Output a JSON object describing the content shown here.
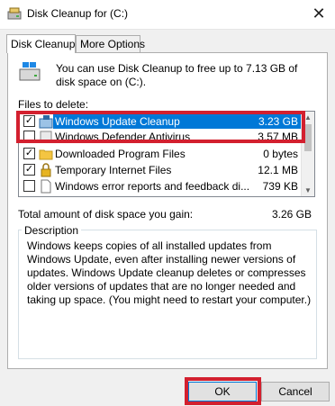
{
  "window": {
    "title": "Disk Cleanup for  (C:)",
    "close_glyph": "✕"
  },
  "tabs": [
    {
      "label": "Disk Cleanup",
      "active": true
    },
    {
      "label": "More Options",
      "active": false
    }
  ],
  "intro_text": "You can use Disk Cleanup to free up to 7.13 GB of disk space on  (C:).",
  "files_label": "Files to delete:",
  "files": [
    {
      "name": "Windows Update Cleanup",
      "size": "3.23 GB",
      "checked": true,
      "selected": true,
      "icon": "windows-update-icon"
    },
    {
      "name": "Windows Defender Antivirus",
      "size": "3.57 MB",
      "checked": false,
      "selected": false,
      "icon": "defender-icon"
    },
    {
      "name": "Downloaded Program Files",
      "size": "0 bytes",
      "checked": true,
      "selected": false,
      "icon": "folder-icon"
    },
    {
      "name": "Temporary Internet Files",
      "size": "12.1 MB",
      "checked": true,
      "selected": false,
      "icon": "lock-icon"
    },
    {
      "name": "Windows error reports and feedback di...",
      "size": "739 KB",
      "checked": false,
      "selected": false,
      "icon": "document-icon"
    }
  ],
  "total": {
    "label": "Total amount of disk space you gain:",
    "value": "3.26 GB"
  },
  "description": {
    "title": "Description",
    "text": "Windows keeps copies of all installed updates from Windows Update, even after installing newer versions of updates. Windows Update cleanup deletes or compresses older versions of updates that are no longer needed and taking up space. (You might need to restart your computer.)"
  },
  "buttons": {
    "ok": "OK",
    "cancel": "Cancel"
  },
  "colors": {
    "highlight": "#0078d7",
    "annotation_red": "#d3202f"
  }
}
